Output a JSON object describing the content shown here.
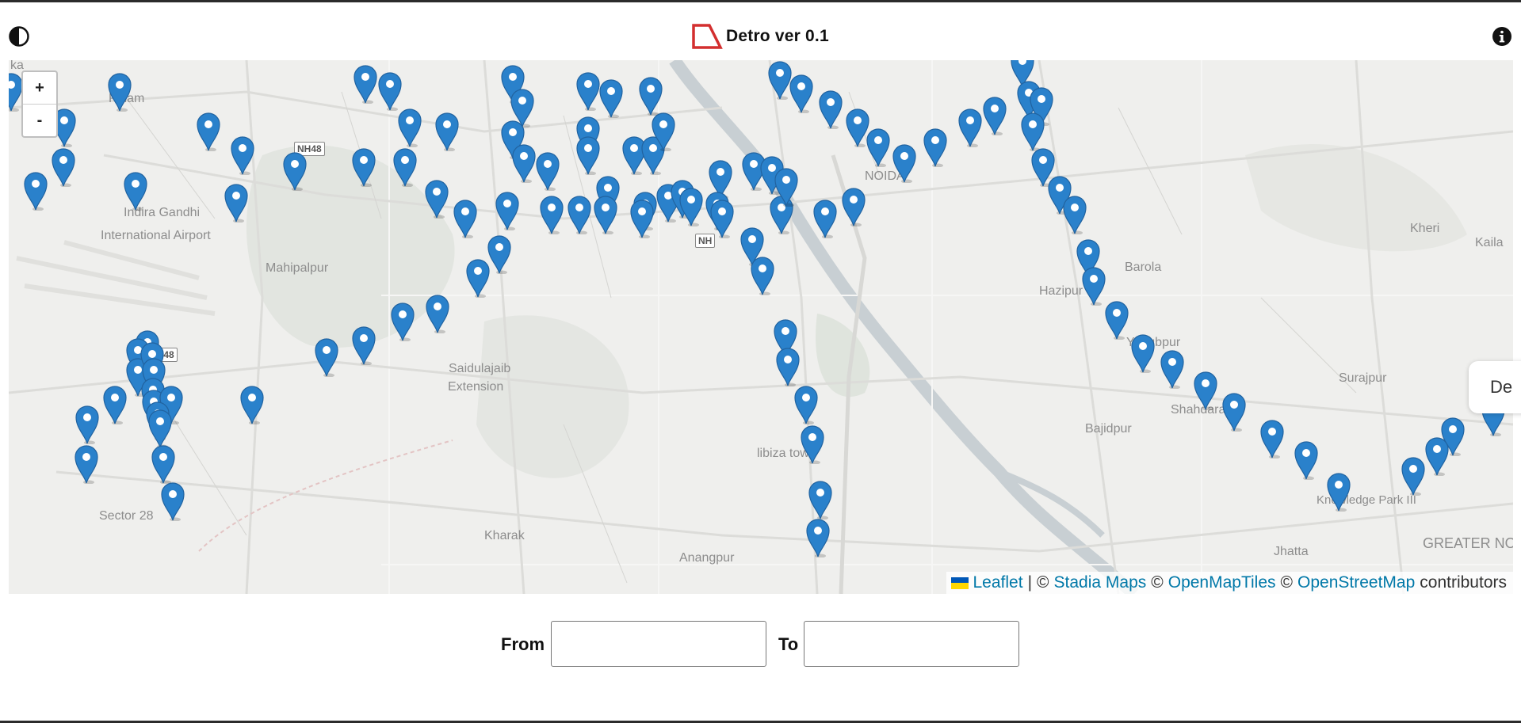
{
  "app": {
    "title": "Detro ver 0.1"
  },
  "header": {
    "theme_toggle_icon": "half-circle-contrast-icon",
    "info_icon": "info-icon",
    "logo_icon": "detro-logo-icon"
  },
  "map": {
    "zoom_in": "+",
    "zoom_out": "-",
    "labels": {
      "airport_1": "Indira Gandhi",
      "airport_2": "International Airport",
      "mahipalpur": "Mahipalpur",
      "palam": "Palam",
      "noida": "NOIDA",
      "hazipur": "Hazipur",
      "barola": "Barola",
      "yaqubpur": "Yaqubpur",
      "bajidpur": "Bajidpur",
      "shahdara": "Shahdara",
      "surajpur": "Surajpur",
      "kheri": "Kheri",
      "kaila": "Kaila",
      "saidulajaib_1": "Saidulajaib",
      "saidulajaib_2": "Extension",
      "libiza": "libiza town",
      "sector28": "Sector 28",
      "kharak": "Kharak",
      "anangpur": "Anangpur",
      "knowledge_park": "Knowledge Park III",
      "jhatta": "Jhatta",
      "greater_noida": "GREATER NOIDA",
      "ka": "ka",
      "nh48_top": "NH48",
      "nh48_bottom": "NH48",
      "nh_mid": "NH"
    },
    "marker_icon": "map-pin-icon",
    "attribution": {
      "leaflet": "Leaflet",
      "sep1": "|",
      "copy1": "©",
      "stadia": "Stadia Maps",
      "copy2": "©",
      "omt": "OpenMapTiles",
      "copy3": "©",
      "osm": "OpenStreetMap",
      "contributors": "contributors"
    },
    "side_card": "De"
  },
  "route": {
    "from_label": "From",
    "to_label": "To",
    "from_value": "",
    "to_value": ""
  },
  "colors": {
    "marker": "#2a81cb",
    "logo": "#d32f2f",
    "link": "#0078a8",
    "map_bg": "#efefed"
  }
}
